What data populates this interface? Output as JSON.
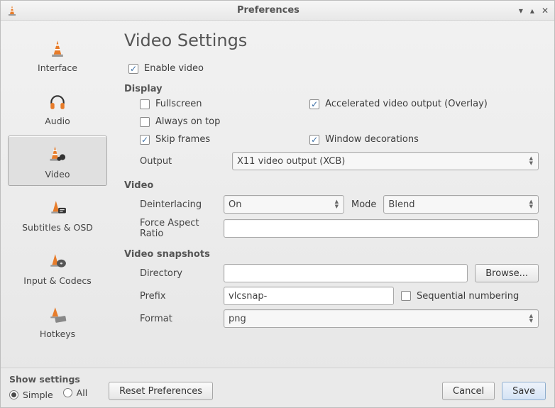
{
  "window": {
    "title": "Preferences"
  },
  "sidebar": {
    "items": [
      {
        "label": "Interface"
      },
      {
        "label": "Audio"
      },
      {
        "label": "Video"
      },
      {
        "label": "Subtitles & OSD"
      },
      {
        "label": "Input & Codecs"
      },
      {
        "label": "Hotkeys"
      }
    ],
    "selected_index": 2
  },
  "page": {
    "title": "Video Settings",
    "enable_video": {
      "label": "Enable video",
      "checked": true
    },
    "display": {
      "heading": "Display",
      "fullscreen": {
        "label": "Fullscreen",
        "checked": false
      },
      "accelerated": {
        "label": "Accelerated video output (Overlay)",
        "checked": true
      },
      "always_on_top": {
        "label": "Always on top",
        "checked": false
      },
      "skip_frames": {
        "label": "Skip frames",
        "checked": true
      },
      "window_decorations": {
        "label": "Window decorations",
        "checked": true
      },
      "output": {
        "label": "Output",
        "value": "X11 video output (XCB)"
      }
    },
    "video": {
      "heading": "Video",
      "deinterlacing": {
        "label": "Deinterlacing",
        "value": "On"
      },
      "mode": {
        "label": "Mode",
        "value": "Blend"
      },
      "force_aspect": {
        "label": "Force Aspect Ratio",
        "value": ""
      }
    },
    "snapshots": {
      "heading": "Video snapshots",
      "directory": {
        "label": "Directory",
        "value": "",
        "browse": "Browse..."
      },
      "prefix": {
        "label": "Prefix",
        "value": "vlcsnap-",
        "sequential": {
          "label": "Sequential numbering",
          "checked": false
        }
      },
      "format": {
        "label": "Format",
        "value": "png"
      }
    }
  },
  "footer": {
    "show_settings": {
      "heading": "Show settings",
      "simple": "Simple",
      "all": "All",
      "selected": "simple"
    },
    "reset": "Reset Preferences",
    "cancel": "Cancel",
    "save": "Save"
  }
}
